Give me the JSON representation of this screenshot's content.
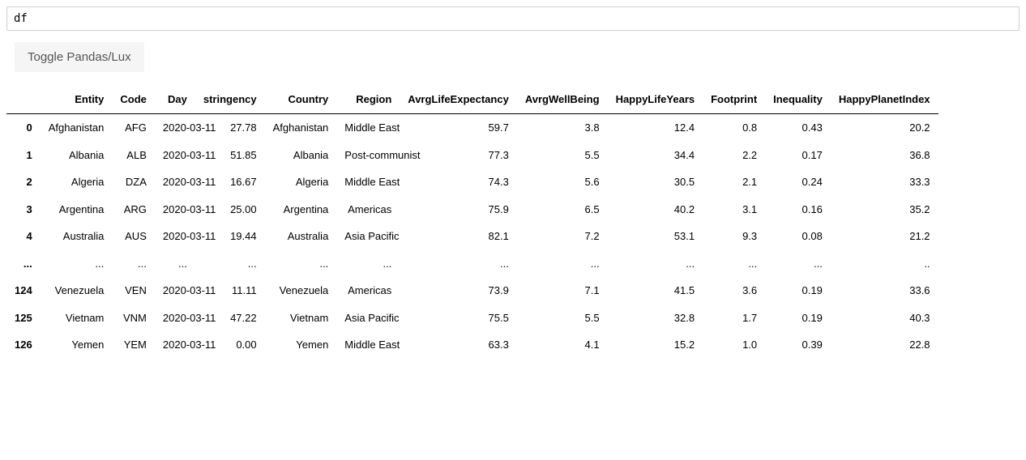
{
  "input": {
    "value": "df"
  },
  "toggle": {
    "label": "Toggle Pandas/Lux"
  },
  "table": {
    "columns": [
      "Entity",
      "Code",
      "Day",
      "stringency",
      "Country",
      "Region",
      "AvrgLifeExpectancy",
      "AvrgWellBeing",
      "HappyLifeYears",
      "Footprint",
      "Inequality",
      "HappyPlanetIndex"
    ],
    "rows": [
      {
        "idx": "0",
        "cells": [
          "Afghanistan",
          "AFG",
          "2020-03-11",
          "27.78",
          "Afghanistan",
          "Middle East",
          "59.7",
          "3.8",
          "12.4",
          "0.8",
          "0.43",
          "20.2"
        ]
      },
      {
        "idx": "1",
        "cells": [
          "Albania",
          "ALB",
          "2020-03-11",
          "51.85",
          "Albania",
          "Post-communist",
          "77.3",
          "5.5",
          "34.4",
          "2.2",
          "0.17",
          "36.8"
        ]
      },
      {
        "idx": "2",
        "cells": [
          "Algeria",
          "DZA",
          "2020-03-11",
          "16.67",
          "Algeria",
          "Middle East",
          "74.3",
          "5.6",
          "30.5",
          "2.1",
          "0.24",
          "33.3"
        ]
      },
      {
        "idx": "3",
        "cells": [
          "Argentina",
          "ARG",
          "2020-03-11",
          "25.00",
          "Argentina",
          "Americas",
          "75.9",
          "6.5",
          "40.2",
          "3.1",
          "0.16",
          "35.2"
        ]
      },
      {
        "idx": "4",
        "cells": [
          "Australia",
          "AUS",
          "2020-03-11",
          "19.44",
          "Australia",
          "Asia Pacific",
          "82.1",
          "7.2",
          "53.1",
          "9.3",
          "0.08",
          "21.2"
        ]
      },
      {
        "idx": "...",
        "cells": [
          "...",
          "...",
          "...",
          "...",
          "...",
          "...",
          "...",
          "...",
          "...",
          "...",
          "...",
          ".."
        ]
      },
      {
        "idx": "124",
        "cells": [
          "Venezuela",
          "VEN",
          "2020-03-11",
          "11.11",
          "Venezuela",
          "Americas",
          "73.9",
          "7.1",
          "41.5",
          "3.6",
          "0.19",
          "33.6"
        ]
      },
      {
        "idx": "125",
        "cells": [
          "Vietnam",
          "VNM",
          "2020-03-11",
          "47.22",
          "Vietnam",
          "Asia Pacific",
          "75.5",
          "5.5",
          "32.8",
          "1.7",
          "0.19",
          "40.3"
        ]
      },
      {
        "idx": "126",
        "cells": [
          "Yemen",
          "YEM",
          "2020-03-11",
          "0.00",
          "Yemen",
          "Middle East",
          "63.3",
          "4.1",
          "15.2",
          "1.0",
          "0.39",
          "22.8"
        ]
      }
    ]
  }
}
